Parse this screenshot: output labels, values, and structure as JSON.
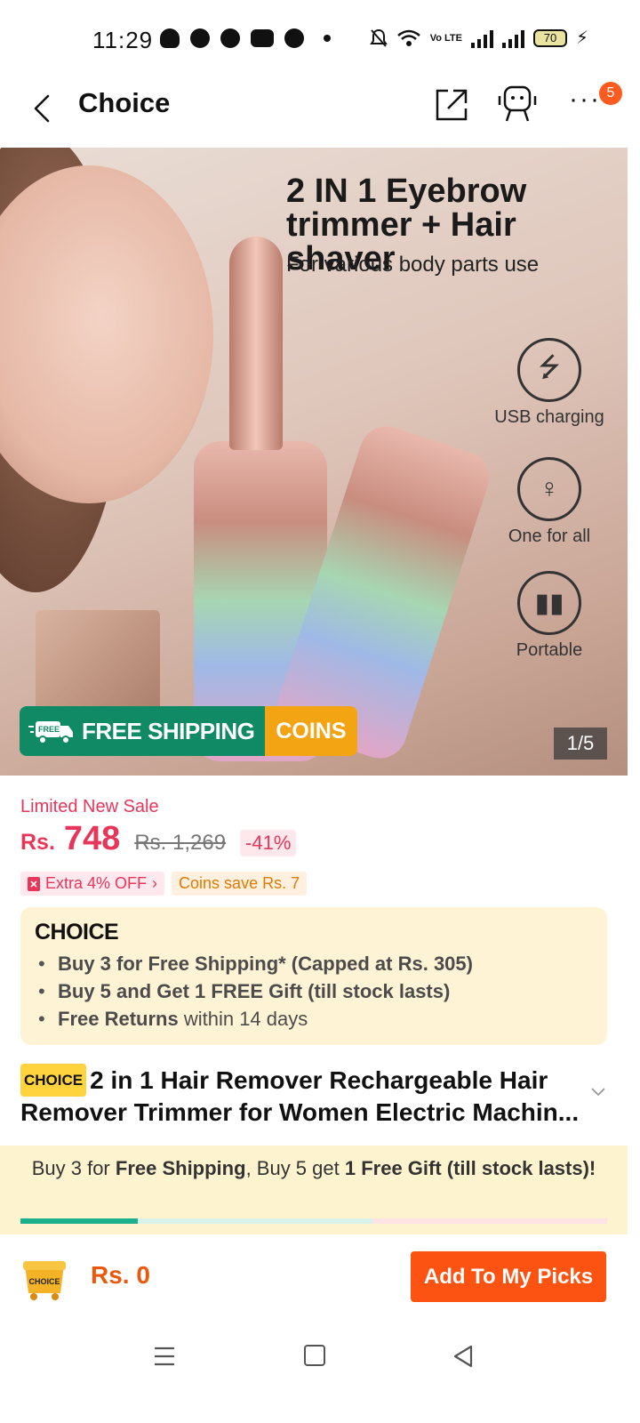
{
  "status": {
    "time": "11:29",
    "battery": "70",
    "network": "Vo LTE"
  },
  "header": {
    "title": "Choice",
    "badge_count": "5"
  },
  "hero": {
    "title_line1": "2 IN 1 Eyebrow",
    "title_line2": "trimmer + Hair shaver",
    "subtitle": "For various body parts use",
    "features": [
      {
        "label": "USB charging",
        "icon": "usb-icon"
      },
      {
        "label": "One for all",
        "icon": "body-icon"
      },
      {
        "label": "Portable",
        "icon": "portable-icon"
      }
    ],
    "free_badge": "FREE",
    "free_shipping": "FREE SHIPPING",
    "coins": "COINS",
    "counter": "1/5"
  },
  "price": {
    "sale_label": "Limited New Sale",
    "currency": "Rs.",
    "current": "748",
    "original": "Rs. 1,269",
    "discount": "-41%",
    "extra_off": "Extra 4% OFF",
    "coins_save": "Coins save Rs. 7"
  },
  "choice": {
    "logo": "CHOICE",
    "items": [
      {
        "bold": "Buy 3 for  Free Shipping* (Capped at Rs. 305)",
        "rest": ""
      },
      {
        "bold": "Buy 5 and Get 1 FREE Gift (till stock lasts)",
        "rest": ""
      },
      {
        "bold": "Free Returns",
        "rest": " within 14 days"
      }
    ]
  },
  "product": {
    "badge": "CHOICE",
    "title": "2 in 1 Hair Remover Rechargeable Hair Remover Trimmer for Women Electric Machin..."
  },
  "bundle": {
    "text_1": "Buy 3 for ",
    "bold_1": "Free Shipping",
    "text_2": ", Buy 5 get ",
    "bold_2": "1 Free Gift (till stock lasts)!",
    "progress": 0.2
  },
  "bottom": {
    "picks_icon_label": "CHOICE",
    "total": "Rs. 0",
    "add_button": "Add To My Picks"
  },
  "colors": {
    "accent": "#fd5312",
    "price": "#e8355a",
    "free_shipping": "#0f8a64",
    "coins": "#f2a413",
    "choice_bg": "#fff3d6"
  }
}
